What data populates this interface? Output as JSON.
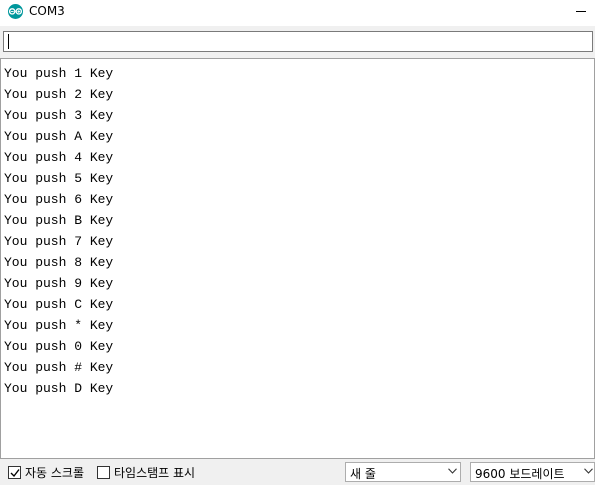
{
  "window": {
    "title": "COM3",
    "app_icon": "arduino-logo-icon"
  },
  "send": {
    "value": ""
  },
  "output": {
    "lines": [
      "You push 1 Key",
      "You push 2 Key",
      "You push 3 Key",
      "You push A Key",
      "You push 4 Key",
      "You push 5 Key",
      "You push 6 Key",
      "You push B Key",
      "You push 7 Key",
      "You push 8 Key",
      "You push 9 Key",
      "You push C Key",
      "You push * Key",
      "You push 0 Key",
      "You push # Key",
      "You push D Key"
    ]
  },
  "status": {
    "autoscroll": {
      "label": "자동 스크롤",
      "checked": true
    },
    "timestamp": {
      "label": "타임스탬프 표시",
      "checked": false
    },
    "line_ending": {
      "value": "새 줄"
    },
    "baud_rate": {
      "value": "9600 보드레이트"
    }
  },
  "colors": {
    "accent": "#00979c",
    "chrome": "#f0f0f0",
    "border": "#a0a0a0"
  }
}
